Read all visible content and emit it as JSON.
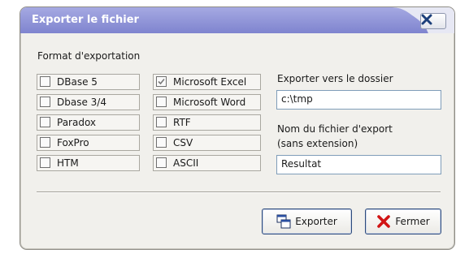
{
  "dialog": {
    "title": "Exporter le fichier",
    "close_icon": "close-x-icon"
  },
  "format": {
    "label": "Format d'exportation",
    "options": [
      {
        "label": "DBase 5",
        "checked": false
      },
      {
        "label": "Dbase 3/4",
        "checked": false
      },
      {
        "label": "Paradox",
        "checked": false
      },
      {
        "label": "FoxPro",
        "checked": false
      },
      {
        "label": "HTM",
        "checked": false
      },
      {
        "label": "Microsoft Excel",
        "checked": true
      },
      {
        "label": "Microsoft Word",
        "checked": false
      },
      {
        "label": "RTF",
        "checked": false
      },
      {
        "label": "CSV",
        "checked": false
      },
      {
        "label": "ASCII",
        "checked": false
      }
    ]
  },
  "export_folder": {
    "label": "Exporter vers le dossier",
    "value": "c:\\tmp"
  },
  "export_filename": {
    "label_line1": "Nom du fichier d'export",
    "label_line2": "(sans extension)",
    "value": "Resultat"
  },
  "buttons": {
    "export_label": "Exporter",
    "export_icon": "export-window-icon",
    "close_label": "Fermer",
    "close_icon": "red-x-icon"
  },
  "colors": {
    "titlebar": "#8a8fd6",
    "titlebar_accent": "#c3c6ee",
    "dialog_bg": "#f1f0ec",
    "close_x": "#1c3f7a",
    "fermer_x": "#d11414"
  }
}
